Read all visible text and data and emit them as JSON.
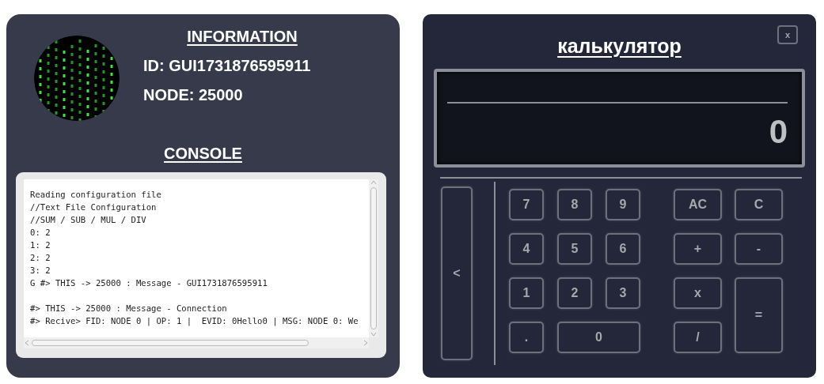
{
  "info": {
    "heading": "INFORMATION",
    "id_line": "ID: GUI1731876595911",
    "node_line": "NODE: 25000"
  },
  "console": {
    "heading": "CONSOLE",
    "blocks": [
      [
        "Reading configuration file",
        "//Text File Configuration",
        "//SUM / SUB / MUL / DIV",
        "0: 2",
        "1: 2",
        "2: 2",
        "3: 2",
        "G #> THIS -> 25000 : Message - GUI1731876595911"
      ],
      [
        "#> THIS -> 25000 : Message - Connection",
        "#> Recive> FID: NODE 0 | OP: 1 |  EVID: 0Hello0 | MSG: NODE 0: We"
      ]
    ]
  },
  "calculator": {
    "title": "калькулятор",
    "close": "x",
    "value": "0",
    "back_key": "<",
    "digit_keys": [
      {
        "label": "7",
        "kind": "key"
      },
      {
        "label": "8",
        "kind": "key"
      },
      {
        "label": "9",
        "kind": "key"
      },
      {
        "label": "4",
        "kind": "key"
      },
      {
        "label": "5",
        "kind": "key"
      },
      {
        "label": "6",
        "kind": "key"
      },
      {
        "label": "1",
        "kind": "key"
      },
      {
        "label": "2",
        "kind": "key"
      },
      {
        "label": "3",
        "kind": "key"
      },
      {
        "label": ".",
        "kind": "key"
      },
      {
        "label": "0",
        "kind": "wide"
      }
    ],
    "operator_keys": [
      {
        "label": "AC",
        "kind": "key"
      },
      {
        "label": "C",
        "kind": "key"
      },
      {
        "label": "+",
        "kind": "key"
      },
      {
        "label": "-",
        "kind": "key"
      },
      {
        "label": "x",
        "kind": "key"
      },
      {
        "label": "=",
        "kind": "tall"
      },
      {
        "label": "/",
        "kind": "key"
      }
    ]
  }
}
